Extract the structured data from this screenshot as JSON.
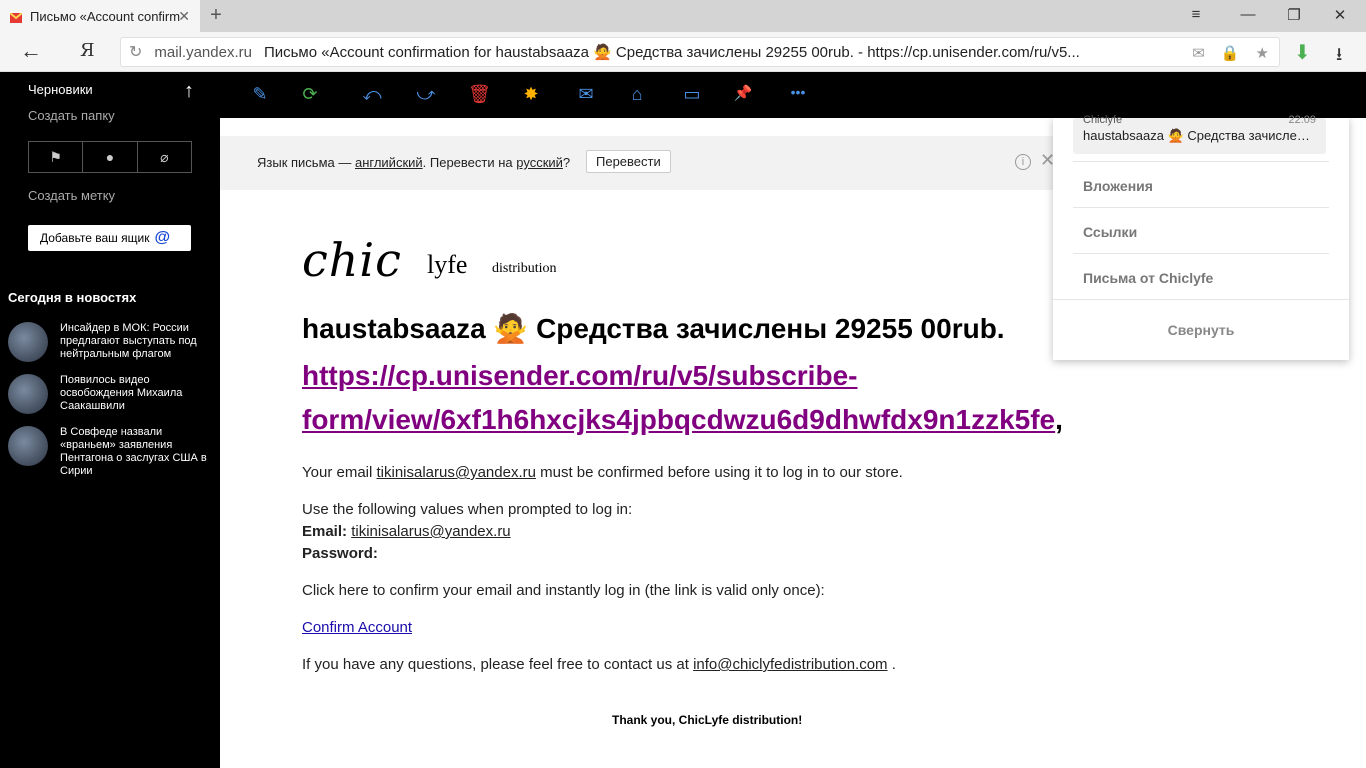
{
  "browser": {
    "tab_title": "Письмо «Account confirm",
    "tab_close": "✕",
    "new_tab": "+",
    "window_menu": "≡",
    "window_minimize": "—",
    "window_restore": "❐",
    "window_close": "✕",
    "back": "←",
    "yandex": "Я",
    "reload": "↻",
    "domain": "mail.yandex.ru",
    "page_title": "Письмо «Account confirmation for haustabsaaza 🙅 Средства зачислены 29255 00rub. - https://cp.unisender.com/ru/v5...",
    "omni_mail": "✉",
    "omni_lock": "🔒",
    "omni_star": "★",
    "download_green": "⬇",
    "download": "⭳"
  },
  "sidebar": {
    "drafts": "Черновики",
    "scroll_up": "↑",
    "create_folder": "Создать папку",
    "filter_flag": "⚑",
    "filter_dot": "●",
    "filter_clip": "⌀",
    "create_label": "Создать метку",
    "add_box": "Добавьте ваш ящик",
    "add_box_at": "@",
    "news_heading": "Сегодня в новостях",
    "news": [
      {
        "text": "Инсайдер в МОК: России предлагают выступать под нейтральным флагом"
      },
      {
        "text": "Появилось видео освобождения Михаила Саакашвили"
      },
      {
        "text": "В Совфеде назвали «враньем» заявления Пентагона о заслугах США в Сирии"
      }
    ]
  },
  "toolbar": {
    "compose": "✎",
    "refresh": "⟳",
    "reply": "⤺",
    "forward": "⤻",
    "delete": "🗑",
    "spam": "✸",
    "mark_read": "✉",
    "archive": "⌂",
    "move_folder": "▭",
    "pin": "📌",
    "more": "•••"
  },
  "translate": {
    "prefix": "Язык письма — ",
    "lang": "английский",
    "middle": ". Перевести на ",
    "target": "русский",
    "suffix": "?",
    "button": "Перевести",
    "info": "i",
    "close": "✕"
  },
  "email": {
    "logo_chic": "chic",
    "logo_lyfe": "lyfe",
    "logo_dist": "distribution",
    "subject": "haustabsaaza 🙅 Средства зачислены 29255 00rub.",
    "link": "https://cp.unisender.com/ru/v5/subscribe-form/view/6xf1h6hxcjks4jpbqcdwzu6d9dhwfdx9n1zzk5fe",
    "link_line1": "https://cp.unisender.com/ru/v5/subscribe-",
    "link_line2": "form/view/6xf1h6hxcjks4jpbqcdwzu6d9dhwfdx9n1zzk5fe",
    "link_comma": ",",
    "p1_prefix": "Your email ",
    "email_addr": "tikinisalarus@yandex.ru",
    "p1_suffix": " must be confirmed before using it to log in to our store.",
    "p2": "Use the following values when prompted to log in:",
    "email_label": "Email:",
    "password_label": "Password:",
    "p3": "Click here to confirm your email and instantly log in (the link is valid only once):",
    "confirm_link": "Confirm Account",
    "p4_prefix": "If you have any questions, please feel free to contact us at ",
    "contact_email": "info@chiclyfedistribution.com",
    "p4_suffix": " .",
    "thanks": "Thank you, ChicLyfe distribution!"
  },
  "right_panel": {
    "msg_from": "Chiclyfe",
    "msg_time": "22:09",
    "msg_subject": "haustabsaaza 🙅 Средства зачисле…",
    "attachments": "Вложения",
    "links": "Ссылки",
    "letters_from": "Письма от Chiclyfe",
    "collapse": "Свернуть"
  }
}
